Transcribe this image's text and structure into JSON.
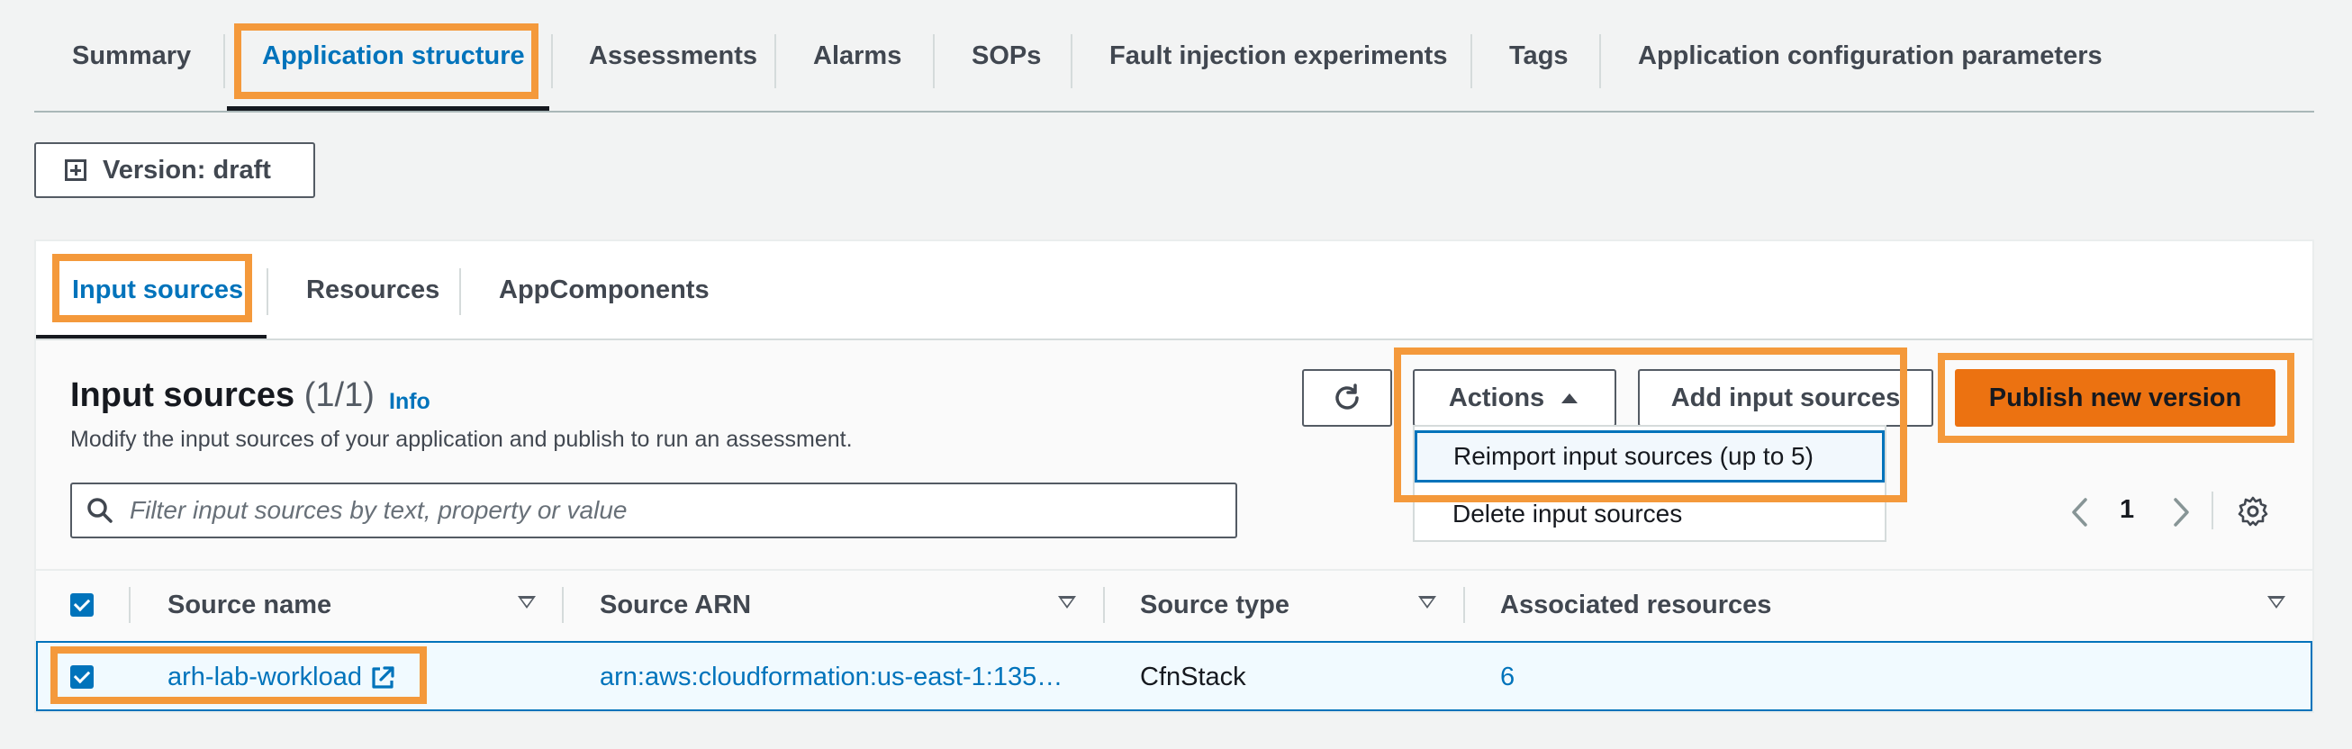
{
  "top_tabs": [
    {
      "label": "Summary"
    },
    {
      "label": "Application structure"
    },
    {
      "label": "Assessments"
    },
    {
      "label": "Alarms"
    },
    {
      "label": "SOPs"
    },
    {
      "label": "Fault injection experiments"
    },
    {
      "label": "Tags"
    },
    {
      "label": "Application configuration parameters"
    }
  ],
  "version_button": {
    "label": "Version: draft",
    "icon": "expand-plus-icon"
  },
  "sub_tabs": [
    {
      "label": "Input sources"
    },
    {
      "label": "Resources"
    },
    {
      "label": "AppComponents"
    }
  ],
  "container": {
    "title": "Input sources",
    "count": "(1/1)",
    "info_link": "Info",
    "description": "Modify the input sources of your application and publish to run an assessment."
  },
  "toolbar": {
    "refresh_icon": "refresh-icon",
    "actions_label": "Actions",
    "add_label": "Add input sources",
    "publish_label": "Publish new version"
  },
  "actions_menu": {
    "items": [
      {
        "label": "Reimport input sources (up to 5)"
      },
      {
        "label": "Delete input sources"
      }
    ]
  },
  "search": {
    "placeholder": "Filter input sources by text, property or value",
    "value": ""
  },
  "pagination": {
    "current_page": "1"
  },
  "table": {
    "columns": [
      {
        "label": "Source name"
      },
      {
        "label": "Source ARN"
      },
      {
        "label": "Source type"
      },
      {
        "label": "Associated resources"
      }
    ],
    "rows": [
      {
        "source_name": "arh-lab-workload",
        "source_arn": "arn:aws:cloudformation:us-east-1:135…",
        "source_type": "CfnStack",
        "associated_resources": "6",
        "selected": true
      }
    ]
  },
  "colors": {
    "accent_link": "#0073bb",
    "primary_button": "#ec7211",
    "highlight_annotation": "#f4993b",
    "background": "#f2f3f3"
  }
}
